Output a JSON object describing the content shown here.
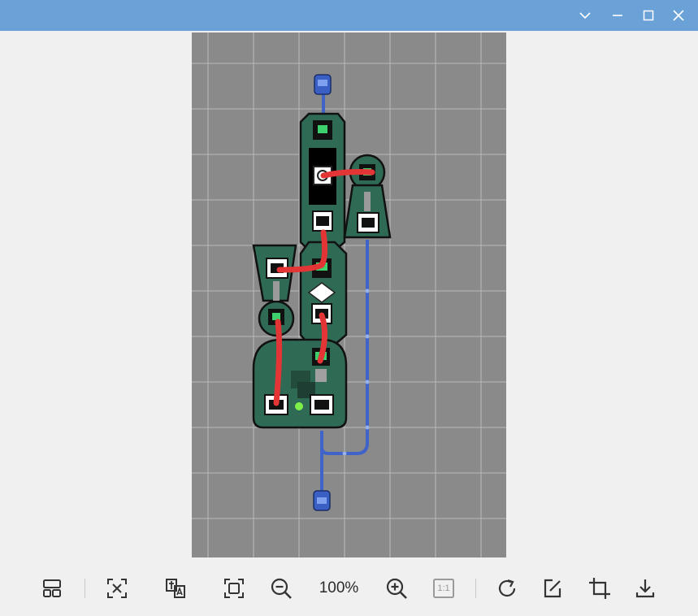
{
  "titlebar": {
    "color": "#6aa2d8",
    "buttons": [
      {
        "name": "dropdown",
        "icon": "chevron-down-icon"
      },
      {
        "name": "minimize",
        "icon": "minimize-icon"
      },
      {
        "name": "maximize",
        "icon": "maximize-icon"
      },
      {
        "name": "close",
        "icon": "close-icon"
      }
    ]
  },
  "canvas": {
    "background": "#8a8a8a",
    "grid_color": "#b9b9b9",
    "board_color": "#2f6a55",
    "wire_color": "#3f63c9",
    "cable_color": "#e33535"
  },
  "toolbar": {
    "zoom_level": "100%",
    "tools": [
      {
        "name": "layout",
        "icon": "layout-icon"
      },
      {
        "name": "fit-selection",
        "icon": "fit-selection-icon"
      },
      {
        "name": "ocr-text",
        "icon": "ocr-text-icon"
      },
      {
        "name": "fit-window",
        "icon": "fit-window-icon"
      },
      {
        "name": "zoom-out",
        "icon": "zoom-out-icon"
      },
      {
        "name": "zoom-in",
        "icon": "zoom-in-icon"
      },
      {
        "name": "actual-size",
        "icon": "actual-size-icon",
        "label": "1:1"
      },
      {
        "name": "rotate",
        "icon": "rotate-icon"
      },
      {
        "name": "edit",
        "icon": "edit-icon"
      },
      {
        "name": "crop",
        "icon": "crop-icon"
      },
      {
        "name": "download",
        "icon": "download-icon"
      }
    ]
  }
}
